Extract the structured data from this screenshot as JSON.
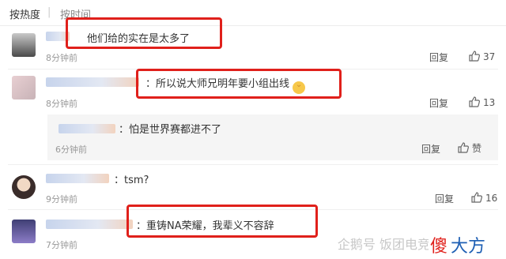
{
  "sort": {
    "hot": "按热度",
    "time": "按时间",
    "separator": "|"
  },
  "comments": [
    {
      "text": "他们给的实在是太多了",
      "time": "8分钟前",
      "reply": "回复",
      "likes": "37"
    },
    {
      "text": "：所以说大师兄明年要小组出线",
      "time": "8分钟前",
      "reply": "回复",
      "likes": "13"
    },
    {
      "text": "：怕是世界赛都进不了",
      "time": "6分钟前",
      "reply": "回复",
      "likes": "赞"
    },
    {
      "text": "：tsm?",
      "time": "9分钟前",
      "reply": "回复",
      "likes": "16"
    },
    {
      "text": "：重铸NA荣耀，我辈义不容辞",
      "time": "7分钟前",
      "reply": "回复",
      "likes": ""
    }
  ],
  "watermark": {
    "text": "企鹅号 饭团电竞",
    "logo_a": "傻",
    "logo_b": "大方"
  },
  "colors": {
    "highlight": "#e0201b",
    "logo_a": "#e0201b",
    "logo_b": "#1e5fb4"
  }
}
